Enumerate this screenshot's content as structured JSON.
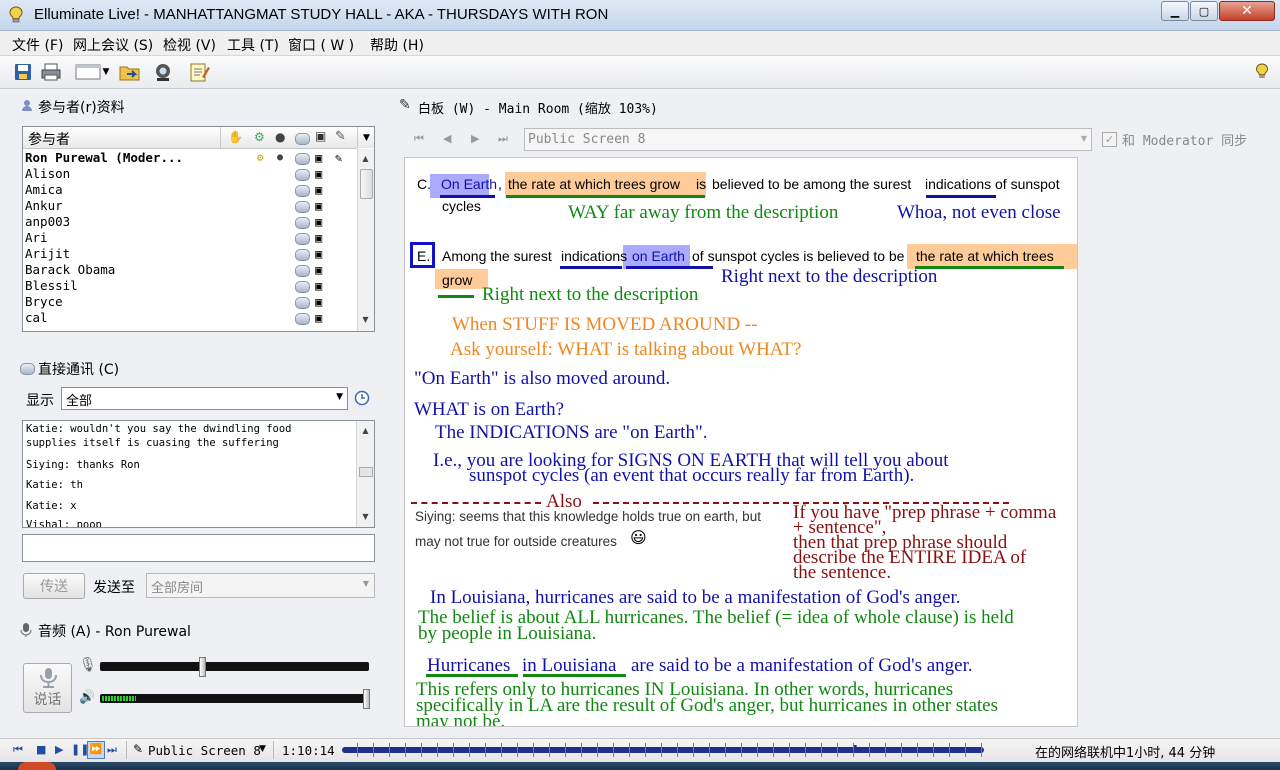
{
  "window": {
    "title": "Elluminate Live! - MANHATTANGMAT STUDY HALL - AKA - THURSDAYS WITH RON"
  },
  "menu": [
    {
      "label": "文件 (F)"
    },
    {
      "label": "网上会议 (S)"
    },
    {
      "label": "检视 (V)"
    },
    {
      "label": "工具 (T)"
    },
    {
      "label": "窗口 ( W )"
    },
    {
      "label": "帮助 (H)"
    }
  ],
  "participants": {
    "title": "参与者(r)资料",
    "column": "参与者",
    "rows": [
      "Ron Purewal (Moder...",
      "Alison",
      "Amica",
      "Ankur",
      "anp003",
      "Ari",
      "Arijit",
      "Barack Obama",
      "Blessil",
      "Bryce",
      "cal"
    ]
  },
  "direct": {
    "title": "直接通讯 (C)",
    "show_label": "显示",
    "filter_value": "全部",
    "messages": [
      "Katie: wouldn't you say the dwindling food supplies itself is cuasing the suffering",
      "Siying: thanks Ron",
      "Katie: th",
      "Katie: x",
      "Vishal: poop"
    ],
    "input_value": "",
    "send_label": "传送",
    "send_to_label": "发送至",
    "send_to_value": "全部房间"
  },
  "audio": {
    "title": "音频 (A) - Ron Purewal",
    "talk_label": "说话",
    "mic_level": 0.38,
    "speaker_level": 1.0
  },
  "whiteboard": {
    "title": "白板 (W) - Main Room (缩放 103%)",
    "screen_value": "Public Screen 8",
    "sync_label": "和 Moderator 同步",
    "sync_checked": true,
    "content": {
      "c_label": "C.",
      "c_on_earth": "On Earth",
      "c_comma": ",",
      "c_rate": "the rate at which trees grow",
      "c_is": "is",
      "c_rest1": "believed to be among the surest",
      "c_indications": "indications",
      "c_rest2": "of sunspot",
      "c_cycles": "cycles",
      "note_way_far": "WAY far away from the description",
      "note_whoa": "Whoa, not even close",
      "e_label": "E.",
      "e_among": "Among the surest",
      "e_indications": "indications",
      "e_on_earth": "on Earth",
      "e_rest": "of sunspot cycles is believed to be",
      "e_rate": "the rate at which trees",
      "e_grow": "grow",
      "note_right_next_blue": "Right next to the description",
      "note_right_next_green": "Right next to the description",
      "orange1": "When STUFF IS MOVED AROUND --",
      "orange2": "Ask yourself: WHAT is talking about WHAT?",
      "blue1": "\"On Earth\" is also moved around.",
      "blue2": "WHAT is on Earth?",
      "blue3": "The INDICATIONS are \"on Earth\".",
      "blue4a": "I.e., you are looking for SIGNS ON EARTH that will tell you about",
      "blue4b": "sunspot cycles (an event that occurs really far from Earth).",
      "also_label": "Also",
      "siying_line1": "Siying: seems that this knowledge holds true on earth, but",
      "siying_line2": "may not true for outside creatures",
      "smiley": "😃",
      "red1": "If you have \"prep phrase + comma",
      "red2": "+ sentence\",",
      "red3": "then that prep phrase should",
      "red4": "describe the ENTIRE IDEA of",
      "red5": "the sentence.",
      "blue5": "In Louisiana, hurricanes are said to be a manifestation of God's anger.",
      "green1a": "The belief is about ALL hurricanes.  The belief (= idea of whole clause) is held",
      "green1b": "by people in Louisiana.",
      "h_hurricanes": "Hurricanes",
      "h_in_louisiana": "in Louisiana",
      "h_rest": "are said to be a manifestation of God's anger.",
      "green2a": "This refers only to hurricanes IN Louisiana.  In other words, hurricanes",
      "green2b": "specifically in LA are the result of God's anger, but hurricanes in other states",
      "green2c": "may not be."
    }
  },
  "status": {
    "screen": "Public Screen 8",
    "time": "1:10:14",
    "progress": 0.8,
    "connection": "在的网络联机中1小时, 44 分钟"
  },
  "colors": {
    "ink_blue": "#1111aa",
    "ink_green": "#118811",
    "ink_orange": "#ee8822",
    "ink_red": "#881111",
    "highlight_orange": "#ffcc99",
    "highlight_blue": "#aaaaff"
  }
}
